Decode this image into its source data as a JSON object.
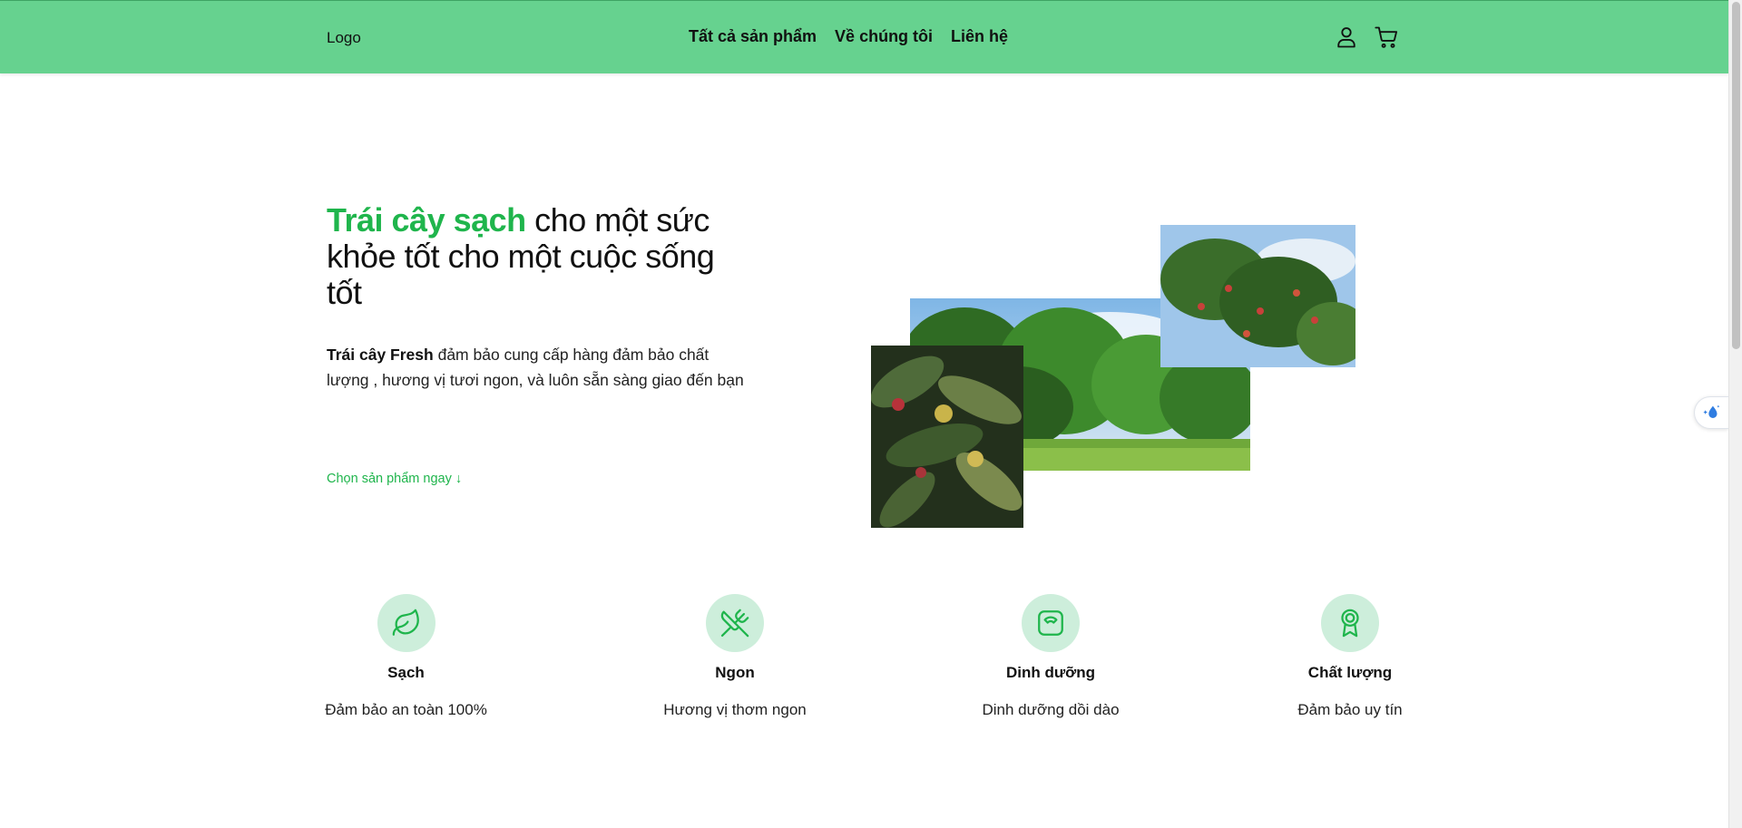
{
  "header": {
    "logo": "Logo",
    "nav": [
      "Tất cả sản phẩm",
      "Về chúng tôi",
      "Liên hệ"
    ],
    "icons": [
      "user-icon",
      "cart-icon"
    ]
  },
  "hero": {
    "title_accent": "Trái cây sạch",
    "title_rest": " cho một sức khỏe tốt cho một cuộc sống tốt",
    "desc_bold": "Trái cây Fresh",
    "desc_rest": " đảm bảo cung cấp hàng đảm bảo chất lượng , hương vị tươi ngon, và luôn sẵn sàng giao đến bạn",
    "cta": "Chọn sản phẩm ngay ↓"
  },
  "features": [
    {
      "icon": "leaf-icon",
      "title": "Sạch",
      "desc": "Đảm bảo an toàn 100%"
    },
    {
      "icon": "utensils-icon",
      "title": "Ngon",
      "desc": "Hương vị thơm ngon"
    },
    {
      "icon": "scale-icon",
      "title": "Dinh dưỡng",
      "desc": "Dinh dưỡng dồi dào"
    },
    {
      "icon": "award-icon",
      "title": "Chất lượng",
      "desc": "Đảm bảo uy tín"
    }
  ],
  "colors": {
    "header_bg": "#66d28f",
    "accent": "#1fb54c",
    "icon_circle": "#cdeedb"
  }
}
